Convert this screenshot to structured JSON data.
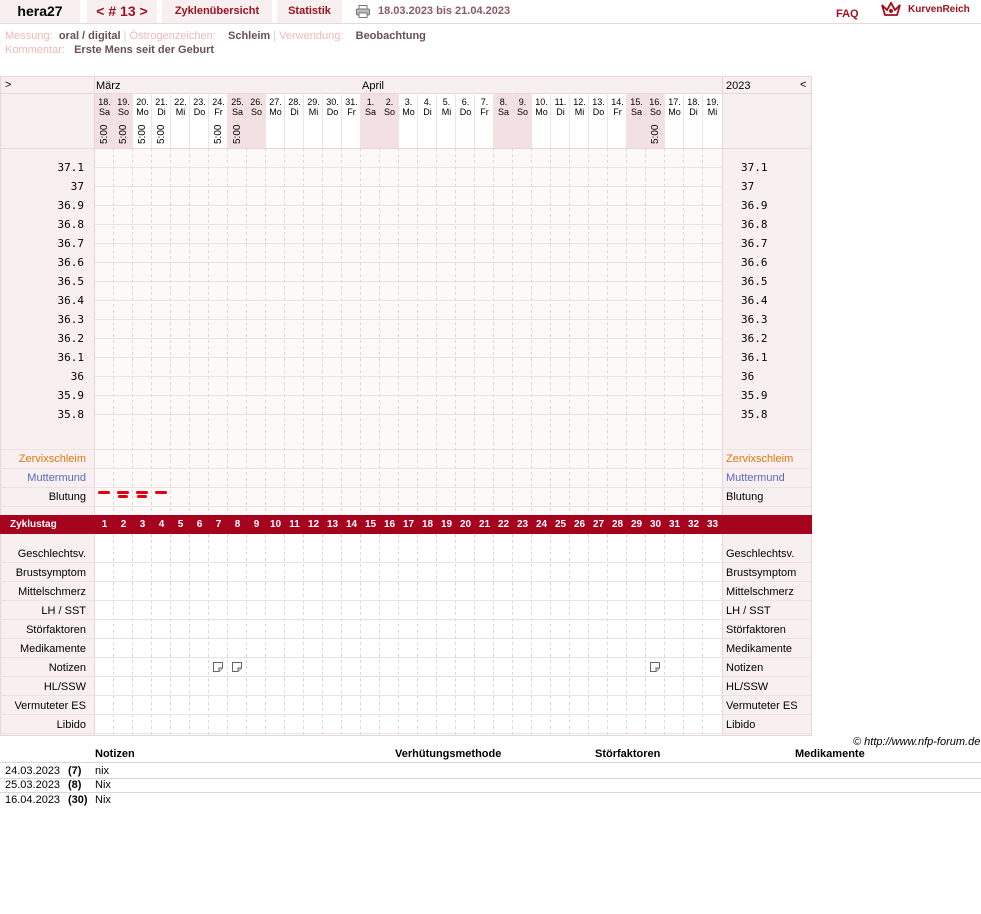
{
  "header": {
    "user": "hera27",
    "cycle_nav": "< # 13 >",
    "tabs": [
      "Zyklenübersicht",
      "Statistik"
    ],
    "date_range": "18.03.2023 bis 21.04.2023",
    "faq": "FAQ",
    "logo": "KurvenReich"
  },
  "meta": {
    "messung_label": "Messung:",
    "messung_value": "oral / digital",
    "oestrogen_label": "Östrogenzeichen:",
    "oestrogen_value": "Schleim",
    "verwendung_label": "Verwendung:",
    "verwendung_value": "Beobachtung",
    "kommentar_label": "Kommentar:",
    "kommentar_value": "Erste Mens seit der Geburt"
  },
  "chart": {
    "nav_left": ">",
    "nav_right": "<",
    "month1": "März",
    "month2": "April",
    "year": "2023",
    "days": [
      {
        "d": "18.",
        "w": "Sa",
        "t": "5:00"
      },
      {
        "d": "19.",
        "w": "So",
        "t": "5:00"
      },
      {
        "d": "20.",
        "w": "Mo",
        "t": "5:00"
      },
      {
        "d": "21.",
        "w": "Di",
        "t": "5:00"
      },
      {
        "d": "22.",
        "w": "Mi",
        "t": ""
      },
      {
        "d": "23.",
        "w": "Do",
        "t": ""
      },
      {
        "d": "24.",
        "w": "Fr",
        "t": "5:00"
      },
      {
        "d": "25.",
        "w": "Sa",
        "t": "5:00"
      },
      {
        "d": "26.",
        "w": "So",
        "t": ""
      },
      {
        "d": "27.",
        "w": "Mo",
        "t": ""
      },
      {
        "d": "28.",
        "w": "Di",
        "t": ""
      },
      {
        "d": "29.",
        "w": "Mi",
        "t": ""
      },
      {
        "d": "30.",
        "w": "Do",
        "t": ""
      },
      {
        "d": "31.",
        "w": "Fr",
        "t": ""
      },
      {
        "d": "1.",
        "w": "Sa",
        "t": ""
      },
      {
        "d": "2.",
        "w": "So",
        "t": ""
      },
      {
        "d": "3.",
        "w": "Mo",
        "t": ""
      },
      {
        "d": "4.",
        "w": "Di",
        "t": ""
      },
      {
        "d": "5.",
        "w": "Mi",
        "t": ""
      },
      {
        "d": "6.",
        "w": "Do",
        "t": ""
      },
      {
        "d": "7.",
        "w": "Fr",
        "t": ""
      },
      {
        "d": "8.",
        "w": "Sa",
        "t": ""
      },
      {
        "d": "9.",
        "w": "So",
        "t": ""
      },
      {
        "d": "10.",
        "w": "Mo",
        "t": ""
      },
      {
        "d": "11.",
        "w": "Di",
        "t": ""
      },
      {
        "d": "12.",
        "w": "Mi",
        "t": ""
      },
      {
        "d": "13.",
        "w": "Do",
        "t": ""
      },
      {
        "d": "14.",
        "w": "Fr",
        "t": ""
      },
      {
        "d": "15.",
        "w": "Sa",
        "t": ""
      },
      {
        "d": "16.",
        "w": "So",
        "t": "5:00"
      },
      {
        "d": "17.",
        "w": "Mo",
        "t": ""
      },
      {
        "d": "18.",
        "w": "Di",
        "t": ""
      },
      {
        "d": "19.",
        "w": "Mi",
        "t": ""
      }
    ],
    "temps": [
      "37.1",
      "37",
      "36.9",
      "36.8",
      "36.7",
      "36.6",
      "36.5",
      "36.4",
      "36.3",
      "36.2",
      "36.1",
      "36",
      "35.9",
      "35.8"
    ],
    "row_zervix": "Zervixschleim",
    "row_mutter": "Muttermund",
    "row_blutung": "Blutung",
    "zyklustag_label": "Zyklustag",
    "cycle_days": [
      "1",
      "2",
      "3",
      "4",
      "5",
      "6",
      "7",
      "8",
      "9",
      "10",
      "11",
      "12",
      "13",
      "14",
      "15",
      "16",
      "17",
      "18",
      "19",
      "20",
      "21",
      "22",
      "23",
      "24",
      "25",
      "26",
      "27",
      "28",
      "29",
      "30",
      "31",
      "32",
      "33"
    ],
    "bleeding_days": [
      1,
      2,
      3,
      4
    ],
    "note_days": [
      7,
      8,
      30
    ],
    "lower_rows": [
      "Geschlechtsv.",
      "Brustsymptom",
      "Mittelschmerz",
      "LH / SST",
      "Störfaktoren",
      "Medikamente",
      "Notizen",
      "HL/SSW",
      "Vermuteter ES",
      "Libido"
    ]
  },
  "copyright": "© http://www.nfp-forum.de",
  "notes_table": {
    "headers": [
      "Notizen",
      "Verhütungsmethode",
      "Störfaktoren",
      "Medikamente"
    ],
    "rows": [
      {
        "date": "24.03.2023",
        "day": "(7)",
        "note": "nix"
      },
      {
        "date": "25.03.2023",
        "day": "(8)",
        "note": "Nix"
      },
      {
        "date": "16.04.2023",
        "day": "(30)",
        "note": "Nix"
      }
    ]
  },
  "colors": {
    "accent": "#a6031e",
    "zervix": "#e07810",
    "mutter": "#5a66c0",
    "bleed": "#e00010"
  }
}
